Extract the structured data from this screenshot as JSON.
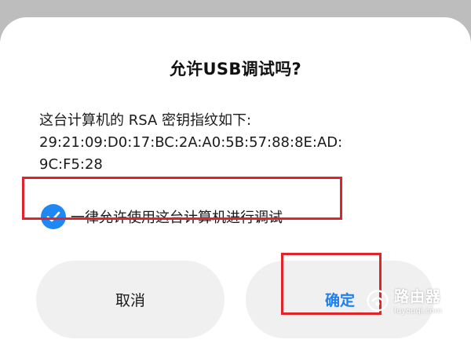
{
  "dialog": {
    "title": "允许USB调试吗?",
    "message_line1": "这台计算机的 RSA 密钥指纹如下:",
    "message_line2": "29:21:09:D0:17:BC:2A:A0:5B:57:88:8E:AD:",
    "message_line3": "9C:F5:28",
    "checkbox": {
      "label": "一律允许使用这台计算机进行调试",
      "checked": true
    },
    "buttons": {
      "cancel_label": "取消",
      "confirm_label": "确定"
    }
  },
  "watermark": {
    "main": "路由器",
    "sub": "luyouqi.com"
  },
  "colors": {
    "accent": "#1e88f5",
    "highlight": "#e0242a",
    "button_bg": "#f0f0f0",
    "backdrop": "#bdbdbd"
  },
  "icons": {
    "checkbox": "check-circle-icon",
    "watermark": "router-logo-icon"
  }
}
